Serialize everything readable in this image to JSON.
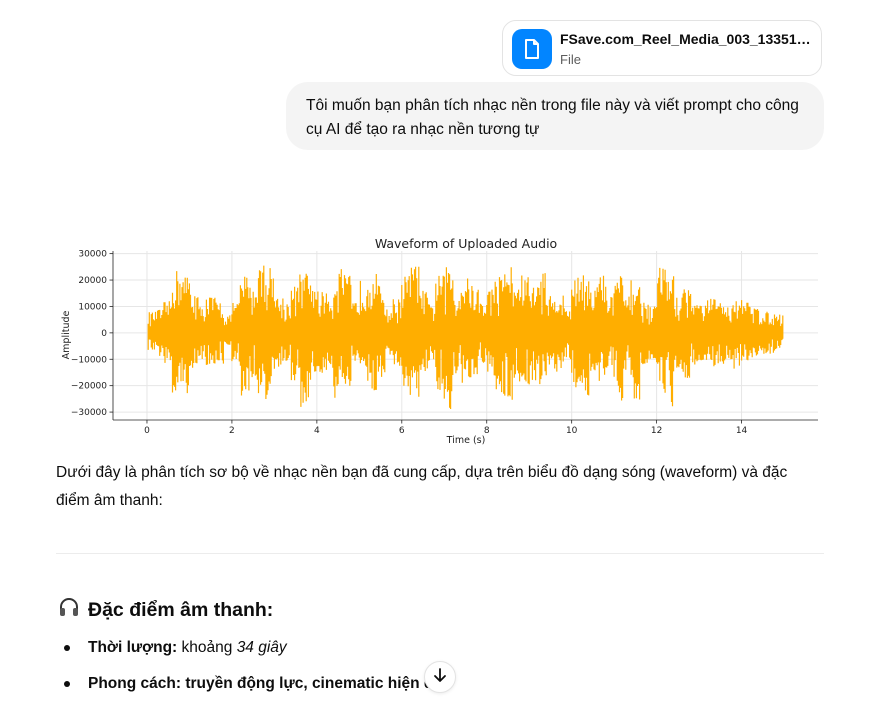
{
  "attachment": {
    "file_name": "FSave.com_Reel_Media_003_13351359...",
    "file_type": "File",
    "icon": "document-icon",
    "icon_color": "#0285ff"
  },
  "user_message": {
    "text": "Tôi muốn bạn phân tích nhạc nền trong file này và viết prompt cho công cụ AI để tạo ra nhạc nền tương tự"
  },
  "chart_data": {
    "type": "line",
    "title": "Waveform of Uploaded Audio",
    "xlabel": "Time (s)",
    "ylabel": "Amplitude",
    "xlim": [
      -0.8,
      15.8
    ],
    "ylim": [
      -33000,
      31000
    ],
    "xticks": [
      0,
      2,
      4,
      6,
      8,
      10,
      12,
      14
    ],
    "yticks": [
      30000,
      20000,
      10000,
      0,
      -10000,
      -20000,
      -30000
    ],
    "ytick_labels": [
      "30000",
      "20000",
      "10000",
      "0",
      "−10000",
      "−20000",
      "−30000"
    ],
    "grid": true,
    "series_color": "#ffae00",
    "series": [
      {
        "x": [
          0.1,
          0.3,
          0.5,
          0.7,
          0.9,
          1.1,
          1.3,
          1.5,
          1.7,
          1.9,
          2.1,
          2.3,
          2.5,
          2.7,
          2.9,
          3.1,
          3.3,
          3.5,
          3.7,
          3.9,
          4.1,
          4.3,
          4.5,
          4.7,
          4.9,
          5.1,
          5.3,
          5.5,
          5.7,
          5.9,
          6.1,
          6.3,
          6.5,
          6.7,
          6.9,
          7.1,
          7.3,
          7.5,
          7.7,
          7.9,
          8.1,
          8.3,
          8.5,
          8.7,
          8.9,
          9.1,
          9.3,
          9.5,
          9.7,
          9.9,
          10.1,
          10.3,
          10.5,
          10.7,
          10.9,
          11.1,
          11.3,
          11.5,
          11.7,
          11.9,
          12.1,
          12.3,
          12.5,
          12.7,
          12.9,
          13.1,
          13.3,
          13.5,
          13.7,
          13.9,
          14.1,
          14.3,
          14.5,
          14.7,
          14.9
        ],
        "max": [
          8000,
          9000,
          12000,
          24000,
          22000,
          16000,
          10000,
          14000,
          12000,
          7000,
          12000,
          22000,
          18000,
          27000,
          25000,
          14000,
          12000,
          18000,
          23000,
          19000,
          16000,
          15000,
          25000,
          22000,
          12000,
          20000,
          24000,
          18000,
          9000,
          13000,
          22000,
          26000,
          16000,
          11000,
          22000,
          25000,
          16000,
          21000,
          18000,
          12000,
          17000,
          22000,
          26000,
          19000,
          22000,
          18000,
          24000,
          14000,
          15000,
          10000,
          21000,
          24000,
          17000,
          22000,
          14000,
          22000,
          14000,
          20000,
          12000,
          10000,
          26000,
          22000,
          14000,
          18000,
          12000,
          11000,
          13000,
          12000,
          10000,
          14000,
          12000,
          10000,
          8000,
          8000,
          7000
        ],
        "min": [
          -7000,
          -9000,
          -12000,
          -26000,
          -23000,
          -16000,
          -10000,
          -14000,
          -12000,
          -7000,
          -12000,
          -25000,
          -17000,
          -27000,
          -24000,
          -14000,
          -12000,
          -18000,
          -29000,
          -18000,
          -16000,
          -15000,
          -25000,
          -22000,
          -12000,
          -14000,
          -22000,
          -17000,
          -9000,
          -13000,
          -21000,
          -25000,
          -15000,
          -11000,
          -22000,
          -30000,
          -16000,
          -21000,
          -18000,
          -12000,
          -17000,
          -23000,
          -26000,
          -19000,
          -21000,
          -18000,
          -22000,
          -13000,
          -15000,
          -10000,
          -21000,
          -24000,
          -17000,
          -21000,
          -14000,
          -27000,
          -14000,
          -26000,
          -12000,
          -10000,
          -23000,
          -28000,
          -14000,
          -18000,
          -12000,
          -11000,
          -13000,
          -12000,
          -10000,
          -14000,
          -12000,
          -10000,
          -8000,
          -8000,
          -7000
        ]
      }
    ]
  },
  "response": {
    "intro": "Dưới đây là phân tích sơ bộ về nhạc nền bạn đã cung cấp, dựa trên biểu đồ dạng sóng (waveform) và đặc điểm âm thanh:",
    "section_icon": "headphones-icon",
    "section_title": "Đặc điểm âm thanh:",
    "bullets": [
      {
        "label": "Thời lượng:",
        "plain": " khoảng ",
        "italic": "34 giây"
      },
      {
        "label": "Phong cách:",
        "plain": " truyền động lực, cinematic hiện đ",
        "italic": ""
      }
    ]
  },
  "scroll_button": {
    "icon": "arrow-down-icon"
  }
}
